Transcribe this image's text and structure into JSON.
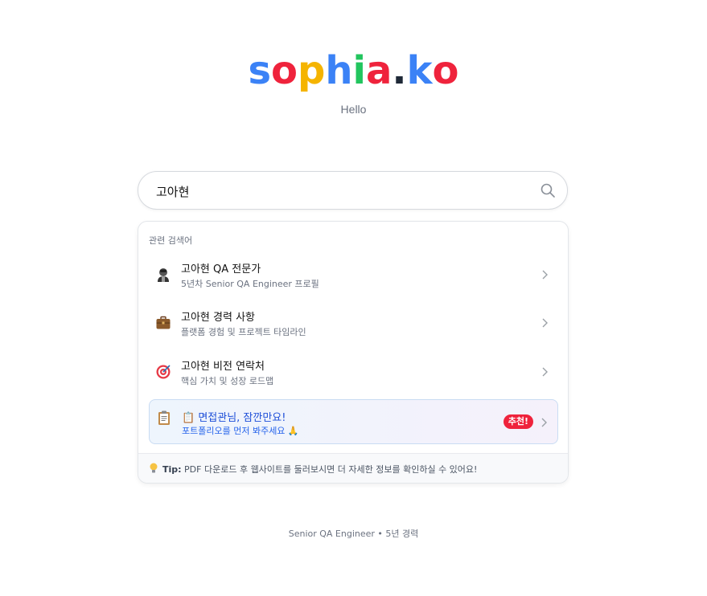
{
  "logo": {
    "letters": [
      {
        "char": "s",
        "color": "#3b82f6"
      },
      {
        "char": "o",
        "color": "#ef233c"
      },
      {
        "char": "p",
        "color": "#f5b400"
      },
      {
        "char": "h",
        "color": "#3b82f6"
      },
      {
        "char": "i",
        "color": "#22c55e"
      },
      {
        "char": "a",
        "color": "#ef233c"
      },
      {
        "char": ".",
        "color": "#1f2937"
      },
      {
        "char": "k",
        "color": "#3b82f6"
      },
      {
        "char": "o",
        "color": "#ef233c"
      }
    ]
  },
  "subtitle": "Hello",
  "search": {
    "value": "고아현",
    "icon": "search-icon"
  },
  "suggestions": {
    "title": "관련 검색어",
    "items": [
      {
        "title": "고아현 QA 전문가",
        "desc": "5년차 Senior QA Engineer 프로필",
        "icon": "person-icon"
      },
      {
        "title": "고아현 경력 사항",
        "desc": "플랫폼 경험 및 프로젝트 타임라인",
        "icon": "briefcase-icon"
      },
      {
        "title": "고아현 비전 연락처",
        "desc": "핵심 가치 및 성장 로드맵",
        "icon": "target-icon"
      },
      {
        "title": "📋 면접관님, 잠깐만요!",
        "desc": "포트폴리오를 먼저 봐주세요 🙏",
        "icon": "clipboard-icon",
        "badge": "추천!"
      }
    ],
    "tip": {
      "label": "Tip:",
      "text": "PDF 다운로드 후 웹사이트를 둘러보시면 더 자세한 정보를 확인하실 수 있어요!"
    }
  },
  "footer": "Senior QA Engineer • 5년 경력",
  "colors": {
    "accent": "#1d4ed8",
    "badge": "#ef233c"
  }
}
